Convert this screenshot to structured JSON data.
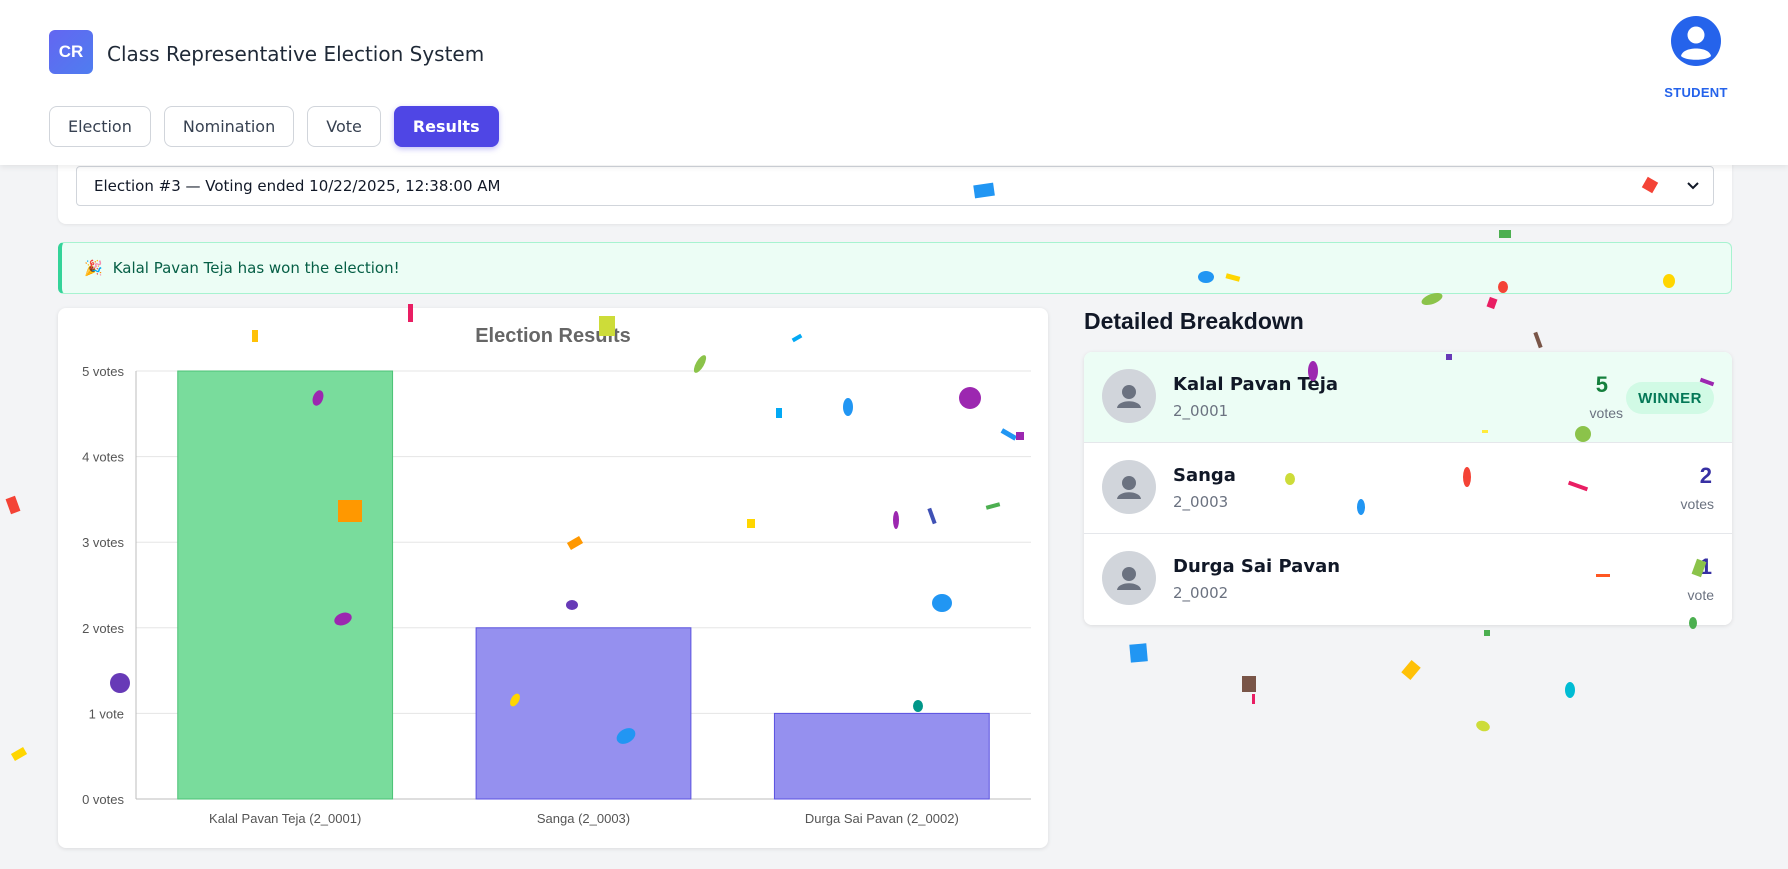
{
  "app": {
    "logo_text": "CR",
    "title": "Class Representative Election System"
  },
  "nav": {
    "tabs": [
      {
        "label": "Election",
        "active": false
      },
      {
        "label": "Nomination",
        "active": false
      },
      {
        "label": "Vote",
        "active": false
      },
      {
        "label": "Results",
        "active": true
      }
    ]
  },
  "user": {
    "icon": "user-circle-icon",
    "role": "STUDENT"
  },
  "election_select": {
    "selected": "Election #3 — Voting ended 10/22/2025, 12:38:00 AM"
  },
  "alert": {
    "emoji": "🎉",
    "message": "Kalal Pavan Teja has won the election!"
  },
  "colors": {
    "accent": "#4f46e5",
    "winner_bar": "#79dc9c",
    "winner_bar_stroke": "#4cc276",
    "other_bar": "#9590ef",
    "other_bar_stroke": "#5b52e0",
    "winner_count": "#15803d",
    "other_count": "#3730a3"
  },
  "chart_data": {
    "type": "bar",
    "title": "Election Results",
    "categories": [
      "Kalal Pavan Teja  (2_0001)",
      "Sanga (2_0003)",
      "Durga Sai Pavan  (2_0002)"
    ],
    "values": [
      5,
      2,
      1
    ],
    "ylim": [
      0,
      5
    ],
    "yticks": [
      "0 votes",
      "1 vote",
      "2 votes",
      "3 votes",
      "4 votes",
      "5 votes"
    ],
    "grid": true,
    "winner_index": 0
  },
  "breakdown": {
    "title": "Detailed Breakdown",
    "winner_badge": "WINNER",
    "candidates": [
      {
        "name": "Kalal Pavan Teja",
        "id": "2_0001",
        "votes": "5",
        "votes_label": "votes",
        "winner": true
      },
      {
        "name": "Sanga",
        "id": "2_0003",
        "votes": "2",
        "votes_label": "votes",
        "winner": false
      },
      {
        "name": "Durga Sai Pavan",
        "id": "2_0002",
        "votes": "1",
        "votes_label": "vote",
        "winner": false
      }
    ]
  }
}
